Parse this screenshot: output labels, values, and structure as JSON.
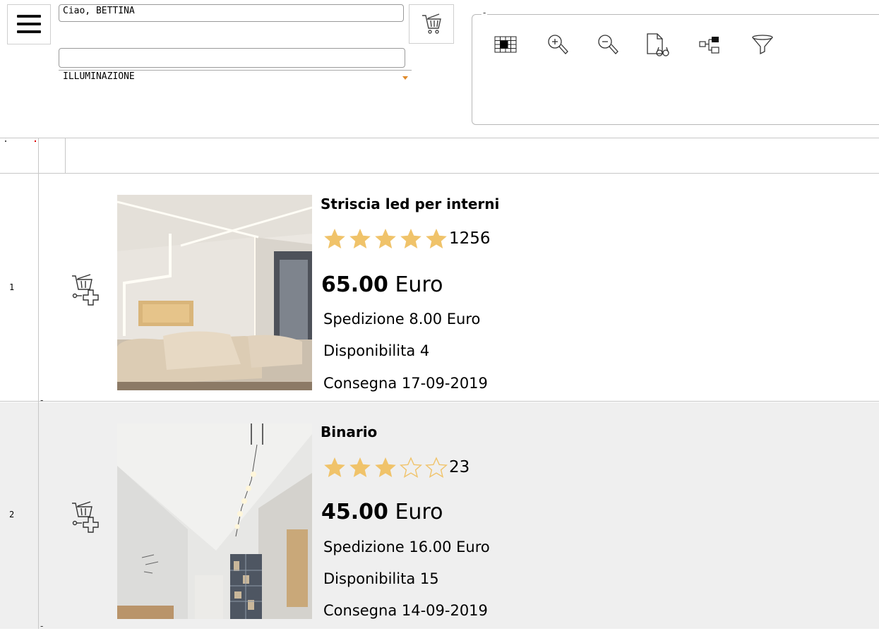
{
  "header": {
    "greeting": "Ciao, BETTINA",
    "search_value": "",
    "category": "ILLUMINAZIONE",
    "toolbox_title": "-",
    "accent_color": "#e08a2b"
  },
  "toolbar_icons": [
    "grid-icon",
    "zoom-in-icon",
    "zoom-out-icon",
    "document-preview-icon",
    "hierarchy-icon",
    "filter-icon"
  ],
  "grid": {
    "row_mark": "-"
  },
  "products": [
    {
      "row": "1",
      "name": "Striscia led per interni",
      "rating": 5,
      "reviews": "1256",
      "price": "65.00",
      "currency": "Euro",
      "shipping": "Spedizione 8.00 Euro",
      "availability": "Disponibilita 4",
      "delivery": "Consegna 17-09-2019"
    },
    {
      "row": "2",
      "name": "Binario",
      "rating": 3,
      "reviews": "23",
      "price": "45.00",
      "currency": "Euro",
      "shipping": "Spedizione 16.00 Euro",
      "availability": "Disponibilita 15",
      "delivery": "Consegna 14-09-2019"
    }
  ],
  "colors": {
    "star": "#f0c36a",
    "row_alt": "#efefef"
  }
}
